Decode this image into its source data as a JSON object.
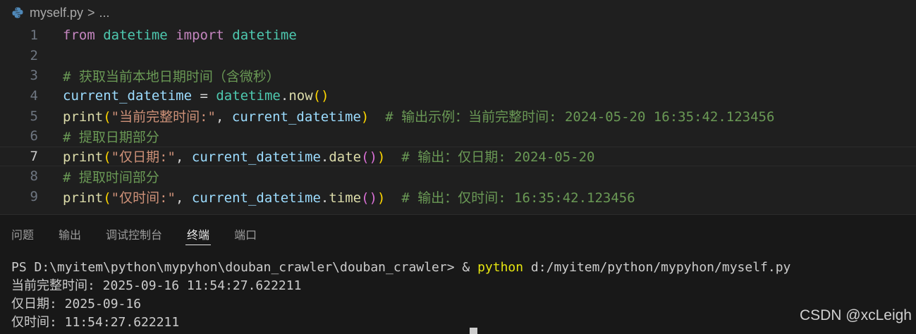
{
  "breadcrumb": {
    "file": "myself.py",
    "sep": ">",
    "more": "..."
  },
  "editor": {
    "current_line": 7,
    "lines": [
      {
        "n": "1",
        "tokens": [
          {
            "t": "from",
            "c": "kw"
          },
          {
            "t": " ",
            "c": "op"
          },
          {
            "t": "datetime",
            "c": "cls"
          },
          {
            "t": " ",
            "c": "op"
          },
          {
            "t": "import",
            "c": "kw"
          },
          {
            "t": " ",
            "c": "op"
          },
          {
            "t": "datetime",
            "c": "cls"
          }
        ]
      },
      {
        "n": "2",
        "tokens": []
      },
      {
        "n": "3",
        "tokens": [
          {
            "t": "# 获取当前本地日期时间（含微秒）",
            "c": "cmt"
          }
        ]
      },
      {
        "n": "4",
        "tokens": [
          {
            "t": "current_datetime",
            "c": "var"
          },
          {
            "t": " = ",
            "c": "op"
          },
          {
            "t": "datetime",
            "c": "cls"
          },
          {
            "t": ".",
            "c": "op"
          },
          {
            "t": "now",
            "c": "fn"
          },
          {
            "t": "()",
            "c": "p1"
          }
        ]
      },
      {
        "n": "5",
        "tokens": [
          {
            "t": "print",
            "c": "fn"
          },
          {
            "t": "(",
            "c": "p1"
          },
          {
            "t": "\"当前完整时间:\"",
            "c": "str"
          },
          {
            "t": ", ",
            "c": "op"
          },
          {
            "t": "current_datetime",
            "c": "var"
          },
          {
            "t": ")",
            "c": "p1"
          },
          {
            "t": "  # 输出示例：当前完整时间: 2024-05-20 16:35:42.123456",
            "c": "cmt"
          }
        ]
      },
      {
        "n": "6",
        "tokens": [
          {
            "t": "# 提取日期部分",
            "c": "cmt"
          }
        ]
      },
      {
        "n": "7",
        "tokens": [
          {
            "t": "print",
            "c": "fn"
          },
          {
            "t": "(",
            "c": "p1"
          },
          {
            "t": "\"仅日期:\"",
            "c": "str"
          },
          {
            "t": ", ",
            "c": "op"
          },
          {
            "t": "current_datetime",
            "c": "var"
          },
          {
            "t": ".",
            "c": "op"
          },
          {
            "t": "date",
            "c": "fn"
          },
          {
            "t": "()",
            "c": "p2"
          },
          {
            "t": ")",
            "c": "p1"
          },
          {
            "t": "  # 输出：仅日期: 2024-05-20",
            "c": "cmt"
          }
        ]
      },
      {
        "n": "8",
        "tokens": [
          {
            "t": "# 提取时间部分",
            "c": "cmt"
          }
        ]
      },
      {
        "n": "9",
        "tokens": [
          {
            "t": "print",
            "c": "fn"
          },
          {
            "t": "(",
            "c": "p1"
          },
          {
            "t": "\"仅时间:\"",
            "c": "str"
          },
          {
            "t": ", ",
            "c": "op"
          },
          {
            "t": "current_datetime",
            "c": "var"
          },
          {
            "t": ".",
            "c": "op"
          },
          {
            "t": "time",
            "c": "fn"
          },
          {
            "t": "()",
            "c": "p2"
          },
          {
            "t": ")",
            "c": "p1"
          },
          {
            "t": "  # 输出：仅时间: 16:35:42.123456",
            "c": "cmt"
          }
        ]
      }
    ]
  },
  "panel": {
    "tabs": [
      {
        "label": "问题",
        "active": false
      },
      {
        "label": "输出",
        "active": false
      },
      {
        "label": "调试控制台",
        "active": false
      },
      {
        "label": "终端",
        "active": true
      },
      {
        "label": "端口",
        "active": false
      }
    ],
    "terminal": {
      "prompt": "PS D:\\myitem\\python\\mypyhon\\douban_crawler\\douban_crawler> & ",
      "command": "python",
      "args": " d:/myitem/python/mypyhon/myself.py",
      "output": [
        "当前完整时间: 2025-09-16 11:54:27.622211",
        "仅日期: 2025-09-16",
        "仅时间: 11:54:27.622211"
      ]
    }
  },
  "watermark": "CSDN @xcLeigh",
  "icons": {
    "file_icon": "python-icon"
  }
}
